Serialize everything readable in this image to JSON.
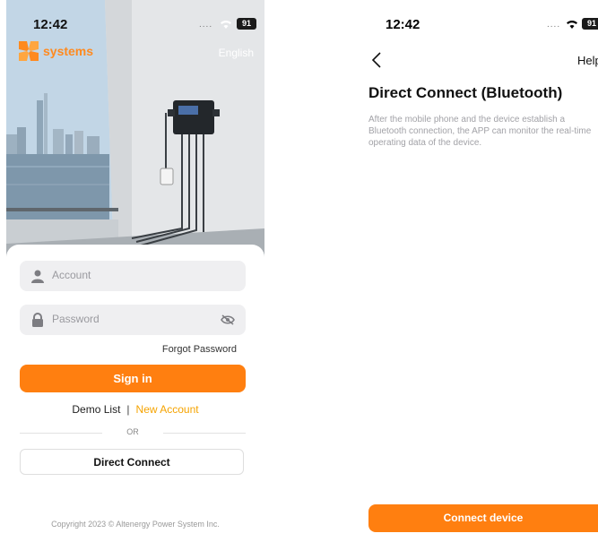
{
  "login": {
    "status": {
      "time": "12:42",
      "battery": "91"
    },
    "brand": {
      "logo_text": "systems",
      "logo_prefix": "AP"
    },
    "language": "English",
    "account_placeholder": "Account",
    "password_placeholder": "Password",
    "forgot_password": "Forgot Password",
    "sign_in": "Sign in",
    "demo_list": "Demo List",
    "separator": "|",
    "new_account": "New Account",
    "or": "OR",
    "direct_connect": "Direct Connect",
    "copyright": "Copyright 2023 © Altenergy Power System Inc.",
    "colors": {
      "accent": "#ff7f10",
      "link": "#f5a300"
    }
  },
  "bluetooth": {
    "status": {
      "time": "12:42",
      "battery": "91"
    },
    "help": "Help",
    "title": "Direct Connect (Bluetooth)",
    "description": "After the mobile phone and the device establish a Bluetooth connection, the APP can monitor the real-time operating data of the device.",
    "connect_button": "Connect device"
  }
}
